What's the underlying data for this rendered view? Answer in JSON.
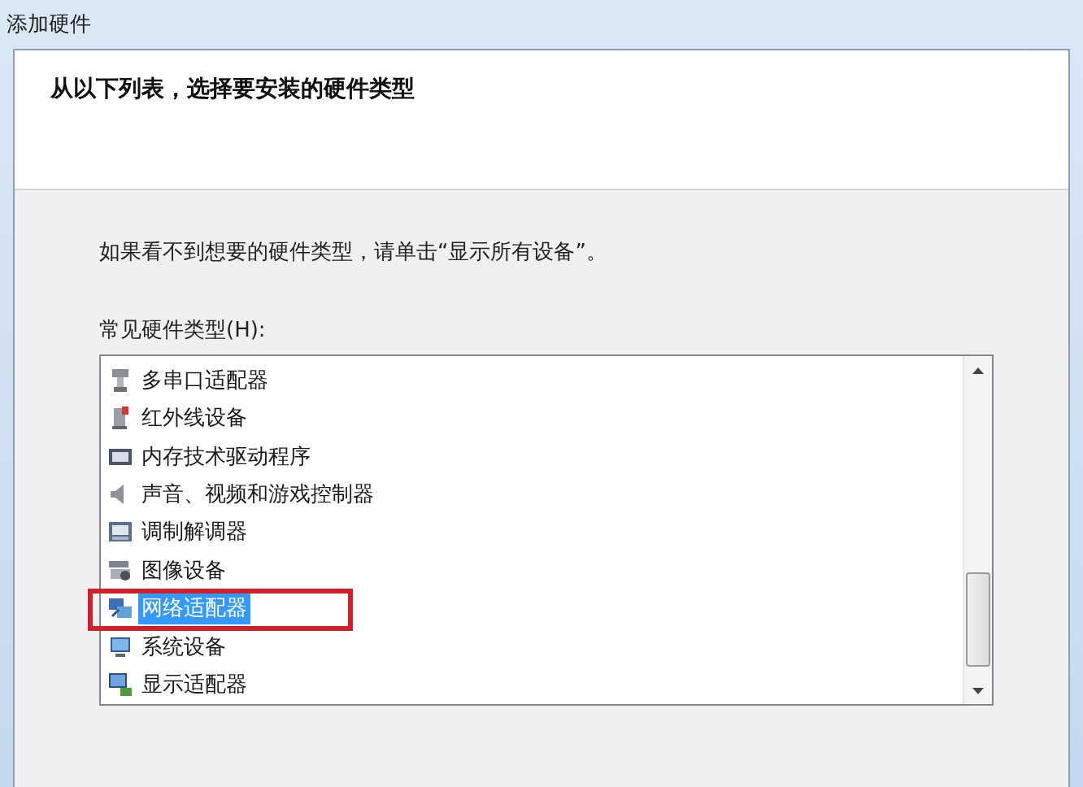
{
  "window": {
    "title": "添加硬件"
  },
  "header": {
    "heading": "从以下列表，选择要安装的硬件类型"
  },
  "instruction": "如果看不到想要的硬件类型，请单击“显示所有设备”。",
  "list_label": "常见硬件类型(H):",
  "hardware_types": [
    {
      "label": "多串口适配器",
      "selected": false,
      "annotated": false
    },
    {
      "label": "红外线设备",
      "selected": false,
      "annotated": false
    },
    {
      "label": "内存技术驱动程序",
      "selected": false,
      "annotated": false
    },
    {
      "label": "声音、视频和游戏控制器",
      "selected": false,
      "annotated": false
    },
    {
      "label": "调制解调器",
      "selected": false,
      "annotated": false
    },
    {
      "label": "图像设备",
      "selected": false,
      "annotated": false
    },
    {
      "label": "网络适配器",
      "selected": true,
      "annotated": true
    },
    {
      "label": "系统设备",
      "selected": false,
      "annotated": false
    },
    {
      "label": "显示适配器",
      "selected": false,
      "annotated": false
    }
  ]
}
